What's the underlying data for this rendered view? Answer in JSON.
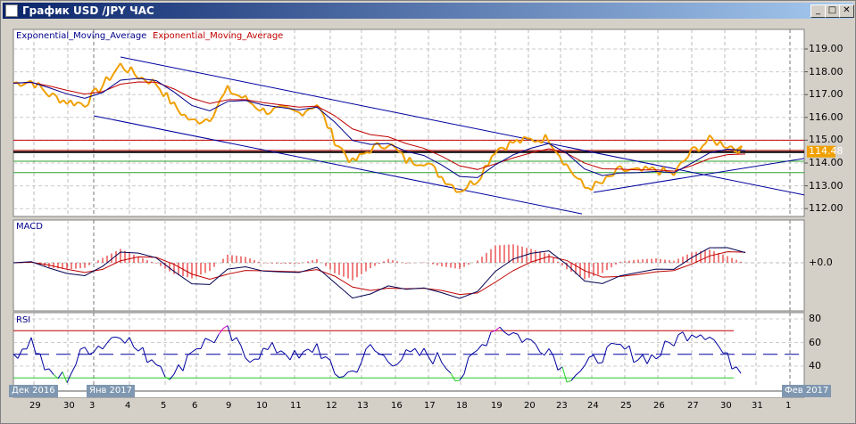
{
  "window": {
    "title": "График USD /JPY  ЧАС",
    "buttons": [
      "minimize",
      "maximize",
      "close"
    ]
  },
  "chart_data": [
    {
      "type": "line",
      "panel": "price",
      "legend": [
        {
          "name": "Exponential_Moving_Average",
          "color": "#00008b"
        },
        {
          "name": "Exponential_Moving_Average",
          "color": "#c00000"
        }
      ],
      "y_ticks": [
        "119.00",
        "118.00",
        "117.00",
        "116.00",
        "115.00",
        "114.00",
        "113.00",
        "112.00"
      ],
      "ylim": [
        111.65,
        119.9
      ],
      "current_price": "114.48",
      "price_color": "#f0a000",
      "price": [
        117.5,
        117.6,
        117.0,
        116.7,
        116.6,
        117.4,
        118.3,
        117.8,
        117.5,
        116.5,
        115.8,
        116.0,
        117.2,
        116.8,
        116.3,
        116.3,
        116.2,
        116.6,
        115.0,
        114.0,
        114.6,
        114.9,
        114.1,
        114.1,
        113.4,
        112.8,
        113.3,
        114.6,
        114.9,
        115.0,
        115.1,
        113.9,
        112.9,
        113.1,
        113.7,
        113.6,
        113.7,
        113.5,
        114.5,
        115.0,
        114.8,
        114.48
      ],
      "horizontal_lines": [
        {
          "value": 115.0,
          "color": "#c00000"
        },
        {
          "value": 114.55,
          "color": "#c00000"
        },
        {
          "value": 114.48,
          "color": "#000000"
        },
        {
          "value": 114.08,
          "color": "#2ca02c"
        },
        {
          "value": 113.58,
          "color": "#2ca02c"
        }
      ],
      "trend_lines": [
        {
          "from": [
            6,
            118.65
          ],
          "to": [
            44.3,
            112.6
          ]
        },
        {
          "from": [
            4.5,
            116.07
          ],
          "to": [
            31.85,
            111.77
          ]
        },
        {
          "from": [
            32.5,
            112.71
          ],
          "to": [
            44.3,
            114.2
          ]
        }
      ]
    },
    {
      "type": "bar+line",
      "panel": "macd",
      "title": "MACD",
      "y_ticks": [
        "+0.0"
      ]
    },
    {
      "type": "line",
      "panel": "rsi",
      "title": "RSI",
      "y_ticks": [
        "80",
        "60",
        "40"
      ],
      "ylim": [
        25,
        85
      ],
      "levels": {
        "overbought": 70,
        "mid": 50,
        "oversold": 30
      },
      "rsi": [
        50,
        62,
        32,
        30,
        55,
        58,
        70,
        52,
        45,
        30,
        55,
        62,
        68,
        48,
        52,
        55,
        45,
        58,
        32,
        35,
        55,
        45,
        48,
        50,
        45,
        30,
        52,
        75,
        68,
        60,
        55,
        32,
        38,
        50,
        55,
        48,
        48,
        62,
        70,
        68,
        45,
        38
      ]
    }
  ],
  "time_axis": {
    "months": [
      "Дек 2016",
      "Янв 2017",
      "Фев 2017"
    ],
    "days": [
      "29",
      "30",
      "3",
      "4",
      "5",
      "6",
      "9",
      "10",
      "11",
      "12",
      "13",
      "16",
      "17",
      "18",
      "19",
      "20",
      "23",
      "24",
      "25",
      "26",
      "27",
      "30",
      "31",
      "1"
    ]
  }
}
